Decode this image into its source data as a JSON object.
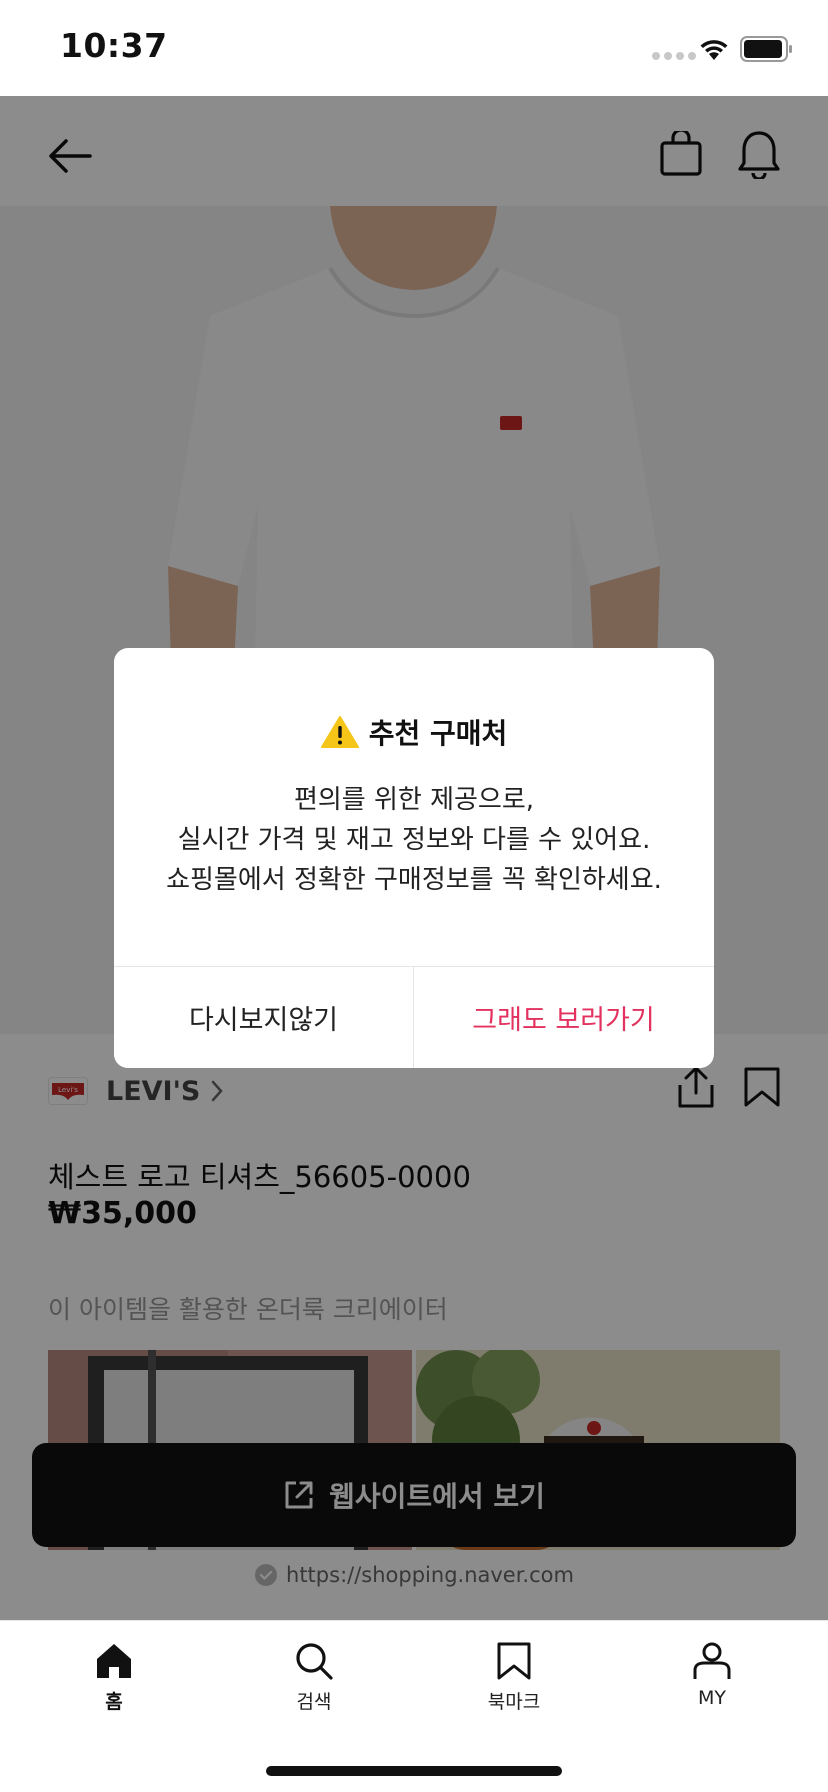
{
  "status_bar": {
    "time": "10:37"
  },
  "product": {
    "brand": "LEVI'S",
    "brand_logo_text": "Levi's",
    "title": "체스트 로고 티셔츠_56605-0000",
    "price": "₩35,000"
  },
  "creators_section": {
    "label": "이 아이템을 활용한 온더룩 크리에이터"
  },
  "website_button": {
    "label": "웹사이트에서 보기"
  },
  "source_url": "https://shopping.naver.com",
  "dialog": {
    "title": "추천 구매처",
    "body_lines": [
      "편의를 위한 제공으로,",
      "실시간 가격 및 재고 정보와 다를 수 있어요.",
      "쇼핑몰에서 정확한 구매정보를 꼭 확인하세요."
    ],
    "dismiss_label": "다시보지않기",
    "continue_label": "그래도 보러가기",
    "continue_color": "#e3325f"
  },
  "tab_bar": {
    "items": [
      {
        "label": "홈",
        "icon": "home-icon",
        "active": true
      },
      {
        "label": "검색",
        "icon": "search-icon",
        "active": false
      },
      {
        "label": "북마크",
        "icon": "bookmark-icon",
        "active": false
      },
      {
        "label": "MY",
        "icon": "person-icon",
        "active": false
      }
    ]
  }
}
